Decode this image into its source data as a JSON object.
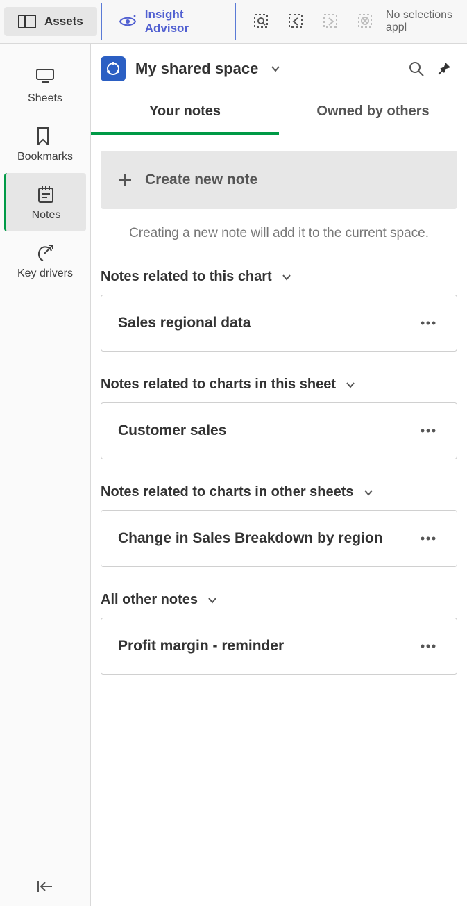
{
  "toolbar": {
    "assets_label": "Assets",
    "insight_label": "Insight Advisor",
    "selections_text": "No selections appl"
  },
  "sidebar": {
    "items": [
      {
        "label": "Sheets"
      },
      {
        "label": "Bookmarks"
      },
      {
        "label": "Notes"
      },
      {
        "label": "Key drivers"
      }
    ]
  },
  "panel": {
    "space_title": "My shared space",
    "tabs": [
      {
        "label": "Your notes"
      },
      {
        "label": "Owned by others"
      }
    ],
    "create_label": "Create new note",
    "help_text": "Creating a new note will add it to the current space.",
    "sections": [
      {
        "title": "Notes related to this chart",
        "notes": [
          {
            "title": "Sales regional data"
          }
        ]
      },
      {
        "title": "Notes related to charts in this sheet",
        "notes": [
          {
            "title": "Customer sales"
          }
        ]
      },
      {
        "title": "Notes related to charts in other sheets",
        "notes": [
          {
            "title": "Change in Sales Breakdown by region"
          }
        ]
      },
      {
        "title": "All other notes",
        "notes": [
          {
            "title": "Profit margin - reminder"
          }
        ]
      }
    ]
  }
}
